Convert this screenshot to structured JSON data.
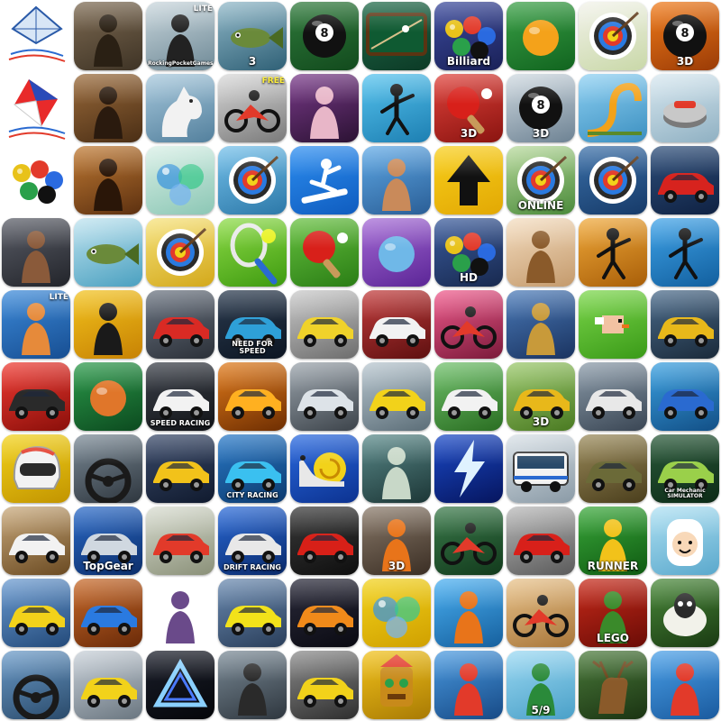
{
  "grid": {
    "columns": 10,
    "rows": 10
  },
  "icons": [
    {
      "name": "kite-logo-blue-icon",
      "bg": [
        "#ffffff",
        "#ffffff"
      ],
      "motif": "kite-blue",
      "bare": true
    },
    {
      "name": "archer-man-icon",
      "bg": [
        "#7d6a52",
        "#3e3325"
      ],
      "motif": "figure",
      "color": "#2a2014"
    },
    {
      "name": "fishing-lite-icon",
      "bg": [
        "#c9d6dc",
        "#6f8a97"
      ],
      "motif": "figure",
      "color": "#222",
      "caption": "RockingPocketGames.com",
      "badge": "LITE"
    },
    {
      "name": "bass-fishing-3-icon",
      "bg": [
        "#8fb7c7",
        "#2f6076"
      ],
      "motif": "fish",
      "caption": "3"
    },
    {
      "name": "eight-ball-table-icon",
      "bg": [
        "#2f7a3b",
        "#124a1d"
      ],
      "motif": "eightball"
    },
    {
      "name": "billiards-table-icon",
      "bg": [
        "#1f6a49",
        "#0c3a26"
      ],
      "motif": "table"
    },
    {
      "name": "billiards-balls-icon",
      "bg": [
        "#3b4a9c",
        "#1a2158"
      ],
      "motif": "balls",
      "caption": "Billiard"
    },
    {
      "name": "snooker-ball-icon",
      "bg": [
        "#3aa046",
        "#11641f"
      ],
      "motif": "ball",
      "color": "#f4a21a"
    },
    {
      "name": "archery-target-girl-icon",
      "bg": [
        "#f2f2ea",
        "#c9d8a8"
      ],
      "motif": "target"
    },
    {
      "name": "eight-ball-3d-icon",
      "bg": [
        "#f07b1a",
        "#9a3b06"
      ],
      "motif": "eightball",
      "caption": "3D"
    },
    {
      "name": "kite-logo-red-icon",
      "bg": [
        "#ffffff",
        "#ffffff"
      ],
      "motif": "kite-red",
      "bare": true
    },
    {
      "name": "apple-shooter-icon",
      "bg": [
        "#9a6a3a",
        "#4a2e15"
      ],
      "motif": "figure",
      "color": "#2a1a0e"
    },
    {
      "name": "horse-icon",
      "bg": [
        "#a7c8dc",
        "#53809d"
      ],
      "motif": "horse"
    },
    {
      "name": "moto-rider-free-icon",
      "bg": [
        "#d9d9d9",
        "#7a7a7a"
      ],
      "motif": "bike",
      "badge": "FREE"
    },
    {
      "name": "volleyball-girl-icon",
      "bg": [
        "#7a3a8a",
        "#2b1233"
      ],
      "motif": "figure",
      "color": "#e8b6c8"
    },
    {
      "name": "stickman-badminton-icon",
      "bg": [
        "#56c3ee",
        "#1d7fb2"
      ],
      "motif": "stick"
    },
    {
      "name": "table-tennis-3d-icon",
      "bg": [
        "#e0423b",
        "#8a1410"
      ],
      "motif": "paddle",
      "caption": "3D"
    },
    {
      "name": "pool-balls-3d-icon",
      "bg": [
        "#cfd9e0",
        "#6d8293"
      ],
      "motif": "eightball",
      "caption": "3D"
    },
    {
      "name": "ramp-loop-icon",
      "bg": [
        "#8ed0f2",
        "#3b8fc0"
      ],
      "motif": "ramp"
    },
    {
      "name": "curling-stone-icon",
      "bg": [
        "#d8e8f0",
        "#8fb0c2"
      ],
      "motif": "curling"
    },
    {
      "name": "billiard-balls-rack-icon",
      "bg": [
        "#ffffff",
        "#ffffff"
      ],
      "motif": "balls",
      "bare": true
    },
    {
      "name": "lion-hunter-icon",
      "bg": [
        "#c07a33",
        "#5c3010"
      ],
      "motif": "figure",
      "color": "#2a1608"
    },
    {
      "name": "bubble-spheres-icon",
      "bg": [
        "#d8efe6",
        "#8cc7b5"
      ],
      "motif": "bubbles"
    },
    {
      "name": "archery-blue-target-icon",
      "bg": [
        "#74c0ea",
        "#2c78a8"
      ],
      "motif": "target"
    },
    {
      "name": "snowboarder-icon",
      "bg": [
        "#2d8ef0",
        "#0f5cbf"
      ],
      "motif": "snowboard"
    },
    {
      "name": "cliff-diver-icon",
      "bg": [
        "#5fa9e6",
        "#2a5e96"
      ],
      "motif": "figure",
      "color": "#c98a5a"
    },
    {
      "name": "up-arrow-icon",
      "bg": [
        "#f8cf1b",
        "#e2a804"
      ],
      "motif": "arrow"
    },
    {
      "name": "archery-online-icon",
      "bg": [
        "#b7d99b",
        "#4a8a3a"
      ],
      "motif": "target",
      "caption": "ONLINE"
    },
    {
      "name": "archery-dart-target-icon",
      "bg": [
        "#3a6fa8",
        "#163a68"
      ],
      "motif": "target"
    },
    {
      "name": "red-sports-car-icon",
      "bg": [
        "#2d4e7a",
        "#0f2142"
      ],
      "motif": "car",
      "color": "#d7231e"
    },
    {
      "name": "boxer-icon",
      "bg": [
        "#5b5e68",
        "#22242a"
      ],
      "motif": "figure",
      "color": "#8a5a3a"
    },
    {
      "name": "fishing-catch-icon",
      "bg": [
        "#bfe3ef",
        "#4aa0c0"
      ],
      "motif": "fish"
    },
    {
      "name": "archery-bullseye-icon",
      "bg": [
        "#f6e27a",
        "#d3a81a"
      ],
      "motif": "target"
    },
    {
      "name": "tennis-racket-icon",
      "bg": [
        "#8ddb46",
        "#3e9a10"
      ],
      "motif": "racket"
    },
    {
      "name": "ping-pong-icon",
      "bg": [
        "#66c03e",
        "#2a7d15"
      ],
      "motif": "paddle"
    },
    {
      "name": "bowling-arm-icon",
      "bg": [
        "#a56bd6",
        "#5b2596"
      ],
      "motif": "ball",
      "color": "#6fb8e8"
    },
    {
      "name": "pool-hd-icon",
      "bg": [
        "#3a5b9c",
        "#18294f"
      ],
      "motif": "balls",
      "caption": "HD"
    },
    {
      "name": "anime-boy-icon",
      "bg": [
        "#f4ddc0",
        "#c49a6c"
      ],
      "motif": "figure",
      "color": "#8a5a2a"
    },
    {
      "name": "stickman-tennis-icon",
      "bg": [
        "#f0a93a",
        "#a85e08"
      ],
      "motif": "stick"
    },
    {
      "name": "stickman-jump-icon",
      "bg": [
        "#3fa3e8",
        "#125f9e"
      ],
      "motif": "stick"
    },
    {
      "name": "basketball-boy-lite-icon",
      "bg": [
        "#3c8ad9",
        "#174e92"
      ],
      "motif": "figure",
      "color": "#e68a3a",
      "badge": "LITE"
    },
    {
      "name": "skater-icon",
      "bg": [
        "#f2c21c",
        "#c78204"
      ],
      "motif": "figure",
      "color": "#1a1a1a"
    },
    {
      "name": "mustang-car-icon",
      "bg": [
        "#6a7380",
        "#2b3038"
      ],
      "motif": "car",
      "color": "#d92a24"
    },
    {
      "name": "need-for-speed-icon",
      "bg": [
        "#2a3a4e",
        "#0c1522"
      ],
      "motif": "car",
      "color": "#2ea0d8",
      "caption": "NEED FOR SPEED"
    },
    {
      "name": "parking-truck-icon",
      "bg": [
        "#c9c9c9",
        "#6d6d6d"
      ],
      "motif": "car",
      "color": "#f0d22a"
    },
    {
      "name": "white-sports-car-icon",
      "bg": [
        "#c23a3a",
        "#5e1010"
      ],
      "motif": "car",
      "color": "#f2f2f2"
    },
    {
      "name": "police-bike-icon",
      "bg": [
        "#f05a8c",
        "#7a1a3a"
      ],
      "motif": "bike"
    },
    {
      "name": "robot-mech-icon",
      "bg": [
        "#4a7ab8",
        "#1a3360"
      ],
      "motif": "figure",
      "color": "#c89a3a"
    },
    {
      "name": "pixel-bird-icon",
      "bg": [
        "#7bd64a",
        "#3a9a18"
      ],
      "motif": "bird"
    },
    {
      "name": "hover-ship-icon",
      "bg": [
        "#4a6a8a",
        "#1a2a3a"
      ],
      "motif": "car",
      "color": "#e8b81a"
    },
    {
      "name": "red-buggy-icon",
      "bg": [
        "#ef3a32",
        "#8a0f0a"
      ],
      "motif": "car",
      "color": "#2a2a2a"
    },
    {
      "name": "bird-basketball-icon",
      "bg": [
        "#2b9a4a",
        "#0c4a1f"
      ],
      "motif": "ball",
      "color": "#e0762a"
    },
    {
      "name": "speed-racing-icon",
      "bg": [
        "#3a3f48",
        "#121418"
      ],
      "motif": "car",
      "color": "#f2f2f2",
      "caption": "SPEED RACING"
    },
    {
      "name": "orange-supercar-icon",
      "bg": [
        "#e07a1a",
        "#6e2e02"
      ],
      "motif": "car",
      "color": "#ffb020"
    },
    {
      "name": "silver-car-icon",
      "bg": [
        "#9aa3ab",
        "#3d444b"
      ],
      "motif": "car",
      "color": "#dde3e8"
    },
    {
      "name": "yellow-convertible-icon",
      "bg": [
        "#b8c6cf",
        "#5c6e78"
      ],
      "motif": "car",
      "color": "#f2d21a"
    },
    {
      "name": "off-road-suv-icon",
      "bg": [
        "#6fc06a",
        "#2a6e22"
      ],
      "motif": "car",
      "color": "#f2f2f2"
    },
    {
      "name": "dump-truck-3d-icon",
      "bg": [
        "#9ac86a",
        "#4a7a22"
      ],
      "motif": "car",
      "color": "#e8b81a",
      "caption": "3D"
    },
    {
      "name": "truck-cab-icon",
      "bg": [
        "#8a9aa8",
        "#3a4654"
      ],
      "motif": "car",
      "color": "#e8e8e8"
    },
    {
      "name": "monster-truck-icon",
      "bg": [
        "#3aa0e0",
        "#124f86"
      ],
      "motif": "car",
      "color": "#2a6ad0"
    },
    {
      "name": "racing-helmet-icon",
      "bg": [
        "#f2d21a",
        "#c29400"
      ],
      "motif": "helmet"
    },
    {
      "name": "car-dashboard-icon",
      "bg": [
        "#7b8a96",
        "#2e363e"
      ],
      "motif": "wheel"
    },
    {
      "name": "yellow-camaro-icon",
      "bg": [
        "#3a4a6a",
        "#101a2e"
      ],
      "motif": "car",
      "color": "#f2c21a"
    },
    {
      "name": "city-racing-icon",
      "bg": [
        "#2a7ac8",
        "#0c3a6e"
      ],
      "motif": "car",
      "color": "#3ac0f0",
      "caption": "CITY RACING"
    },
    {
      "name": "snail-racer-icon",
      "bg": [
        "#2a6ae0",
        "#0c3290"
      ],
      "motif": "snail"
    },
    {
      "name": "zombie-runners-icon",
      "bg": [
        "#5a8a8a",
        "#1c3636"
      ],
      "motif": "figure",
      "color": "#c8d8c8"
    },
    {
      "name": "lightning-icon",
      "bg": [
        "#1a4ac8",
        "#06155e"
      ],
      "motif": "bolt"
    },
    {
      "name": "city-bus-icon",
      "bg": [
        "#d8e0e6",
        "#8a9aa6"
      ],
      "motif": "bus"
    },
    {
      "name": "army-truck-icon",
      "bg": [
        "#9a8a5a",
        "#4a3e1c"
      ],
      "motif": "car",
      "color": "#6b6a38"
    },
    {
      "name": "car-mechanic-simulator-icon",
      "bg": [
        "#2a5a3a",
        "#0c2a16"
      ],
      "motif": "car",
      "color": "#9ad04a",
      "caption": "Car Mechanic SIMULATOR"
    },
    {
      "name": "white-suv-drift-icon",
      "bg": [
        "#c8a87a",
        "#6a4a22"
      ],
      "motif": "car",
      "color": "#f2f2f2"
    },
    {
      "name": "top-gear-icon",
      "bg": [
        "#2a6ac8",
        "#0c2e6a"
      ],
      "motif": "car",
      "color": "#d0d8e0",
      "caption": "TopGear"
    },
    {
      "name": "rally-car-icon",
      "bg": [
        "#d8dcd0",
        "#8a9078"
      ],
      "motif": "car",
      "color": "#e23a2a"
    },
    {
      "name": "drift-racing-icon",
      "bg": [
        "#2a6ad8",
        "#0a2a6a"
      ],
      "motif": "car",
      "color": "#e8e8e8",
      "caption": "DRIFT RACING"
    },
    {
      "name": "red-ferrari-icon",
      "bg": [
        "#3a3a3a",
        "#0e0e0e"
      ],
      "motif": "car",
      "color": "#d82018"
    },
    {
      "name": "prison-escape-3d-icon",
      "bg": [
        "#8a7a6a",
        "#3a2e24"
      ],
      "motif": "figure",
      "color": "#e8741a",
      "caption": "3D"
    },
    {
      "name": "mountain-biker-icon",
      "bg": [
        "#3a7a4a",
        "#123a1c"
      ],
      "motif": "bike"
    },
    {
      "name": "red-lancer-icon",
      "bg": [
        "#b8b8b8",
        "#5a5a5a"
      ],
      "motif": "car",
      "color": "#d8201a"
    },
    {
      "name": "jungle-runner-icon",
      "bg": [
        "#3aa83a",
        "#0f5a12"
      ],
      "motif": "figure",
      "color": "#f2c21a",
      "caption": "RUNNER"
    },
    {
      "name": "adventure-finn-icon",
      "bg": [
        "#aee0f2",
        "#5aa8cc"
      ],
      "motif": "finn"
    },
    {
      "name": "yellow-sedan-icon",
      "bg": [
        "#6a9ad0",
        "#234a7a"
      ],
      "motif": "car",
      "color": "#f2d21a"
    },
    {
      "name": "blue-muscle-car-icon",
      "bg": [
        "#c86a2a",
        "#6a2a08"
      ],
      "motif": "car",
      "color": "#2a7ae0"
    },
    {
      "name": "robber-character-icon",
      "bg": [
        "#ffffff",
        "#ffffff"
      ],
      "motif": "figure",
      "color": "#6a4a8a",
      "bare": true
    },
    {
      "name": "highway-racer-icon",
      "bg": [
        "#6a8ab0",
        "#2a3e5a"
      ],
      "motif": "car",
      "color": "#f2e21a"
    },
    {
      "name": "night-supercar-icon",
      "bg": [
        "#2a2a3a",
        "#0a0a12"
      ],
      "motif": "car",
      "color": "#f08a1a"
    },
    {
      "name": "sponge-game-icon",
      "bg": [
        "#f2d21a",
        "#d0a000"
      ],
      "motif": "bubbles"
    },
    {
      "name": "subway-runner-icon",
      "bg": [
        "#4ab0f2",
        "#16609e"
      ],
      "motif": "figure",
      "color": "#e8741a"
    },
    {
      "name": "motocross-icon",
      "bg": [
        "#e8c28a",
        "#a8763a"
      ],
      "motif": "bike"
    },
    {
      "name": "lego-ninja-icon",
      "bg": [
        "#c82a1a",
        "#6a0c06"
      ],
      "motif": "figure",
      "color": "#3a8a2a",
      "caption": "LEGO"
    },
    {
      "name": "shaun-sheep-icon",
      "bg": [
        "#4a8a3a",
        "#1a3a12"
      ],
      "motif": "sheep"
    },
    {
      "name": "cockpit-driving-icon",
      "bg": [
        "#6a9ac8",
        "#2a4a6a"
      ],
      "motif": "wheel"
    },
    {
      "name": "yellow-taxi-icon",
      "bg": [
        "#c8d0d8",
        "#6a7680"
      ],
      "motif": "car",
      "color": "#f2d21a"
    },
    {
      "name": "triangle-logo-icon",
      "bg": [
        "#1a1e2a",
        "#05060a"
      ],
      "motif": "triangle"
    },
    {
      "name": "skateboard-street-icon",
      "bg": [
        "#7a8a96",
        "#2e363e"
      ],
      "motif": "figure",
      "color": "#2a2a2a"
    },
    {
      "name": "yellow-cab-racer-icon",
      "bg": [
        "#8a8a8a",
        "#2e2e2e"
      ],
      "motif": "car",
      "color": "#f2d21a"
    },
    {
      "name": "temple-idol-icon",
      "bg": [
        "#f2c21a",
        "#a87a04"
      ],
      "motif": "idol"
    },
    {
      "name": "street-kid-runner-icon",
      "bg": [
        "#4a9ae0",
        "#174a86"
      ],
      "motif": "figure",
      "color": "#e23a2a"
    },
    {
      "name": "hill-runner-icon",
      "bg": [
        "#9ad8f2",
        "#4aa0c8"
      ],
      "motif": "figure",
      "color": "#2a8a3a",
      "caption": "5/9"
    },
    {
      "name": "deer-hunter-icon",
      "bg": [
        "#4a7a3a",
        "#1a3312"
      ],
      "motif": "deer"
    },
    {
      "name": "baseball-cartoon-icon",
      "bg": [
        "#4aa0e8",
        "#1a5a9e"
      ],
      "motif": "figure",
      "color": "#e23a2a"
    }
  ]
}
